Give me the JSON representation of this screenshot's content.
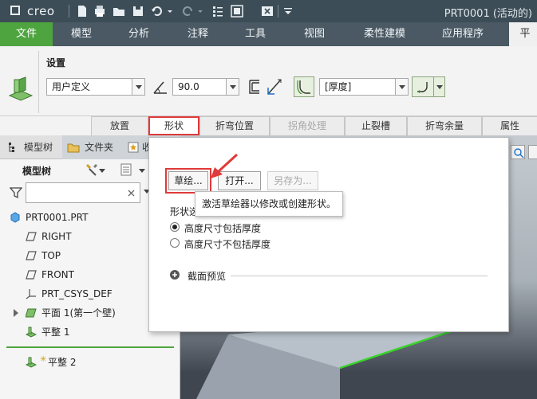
{
  "titlebar": {
    "brand": "creo",
    "window_title": "PRT0001 (活动的)"
  },
  "menubar": {
    "items": [
      "文件",
      "模型",
      "分析",
      "注释",
      "工具",
      "视图",
      "柔性建模",
      "应用程序",
      "平"
    ]
  },
  "ribbon": {
    "group_label": "设置",
    "type_value": "用户定义",
    "angle_value": "90.0",
    "thickness_value": "[厚度]"
  },
  "tabs": [
    "放置",
    "形状",
    "折弯位置",
    "拐角处理",
    "止裂槽",
    "折弯余量",
    "属性"
  ],
  "navtabs": [
    "模型树",
    "文件夹",
    "收"
  ],
  "tree": {
    "header": "模型树",
    "search_placeholder": "",
    "items": [
      "PRT0001.PRT",
      "RIGHT",
      "TOP",
      "FRONT",
      "PRT_CSYS_DEF",
      "平面 1(第一个壁)",
      "平整 1",
      "平整 2"
    ]
  },
  "popup": {
    "sketch_button": "草绘...",
    "open_button": "打开...",
    "saveas_button": "另存为...",
    "shape_label": "形状选",
    "radio_include": "高度尺寸包括厚度",
    "radio_exclude": "高度尺寸不包括厚度",
    "preview_label": "截面预览"
  },
  "tooltip": {
    "text": "激活草绘器以修改或创建形状。"
  },
  "colors": {
    "titlebar": "#3d4d57",
    "menubar": "#4a5963",
    "file_menu": "#4ea53f",
    "highlight": "#e03a3a"
  }
}
